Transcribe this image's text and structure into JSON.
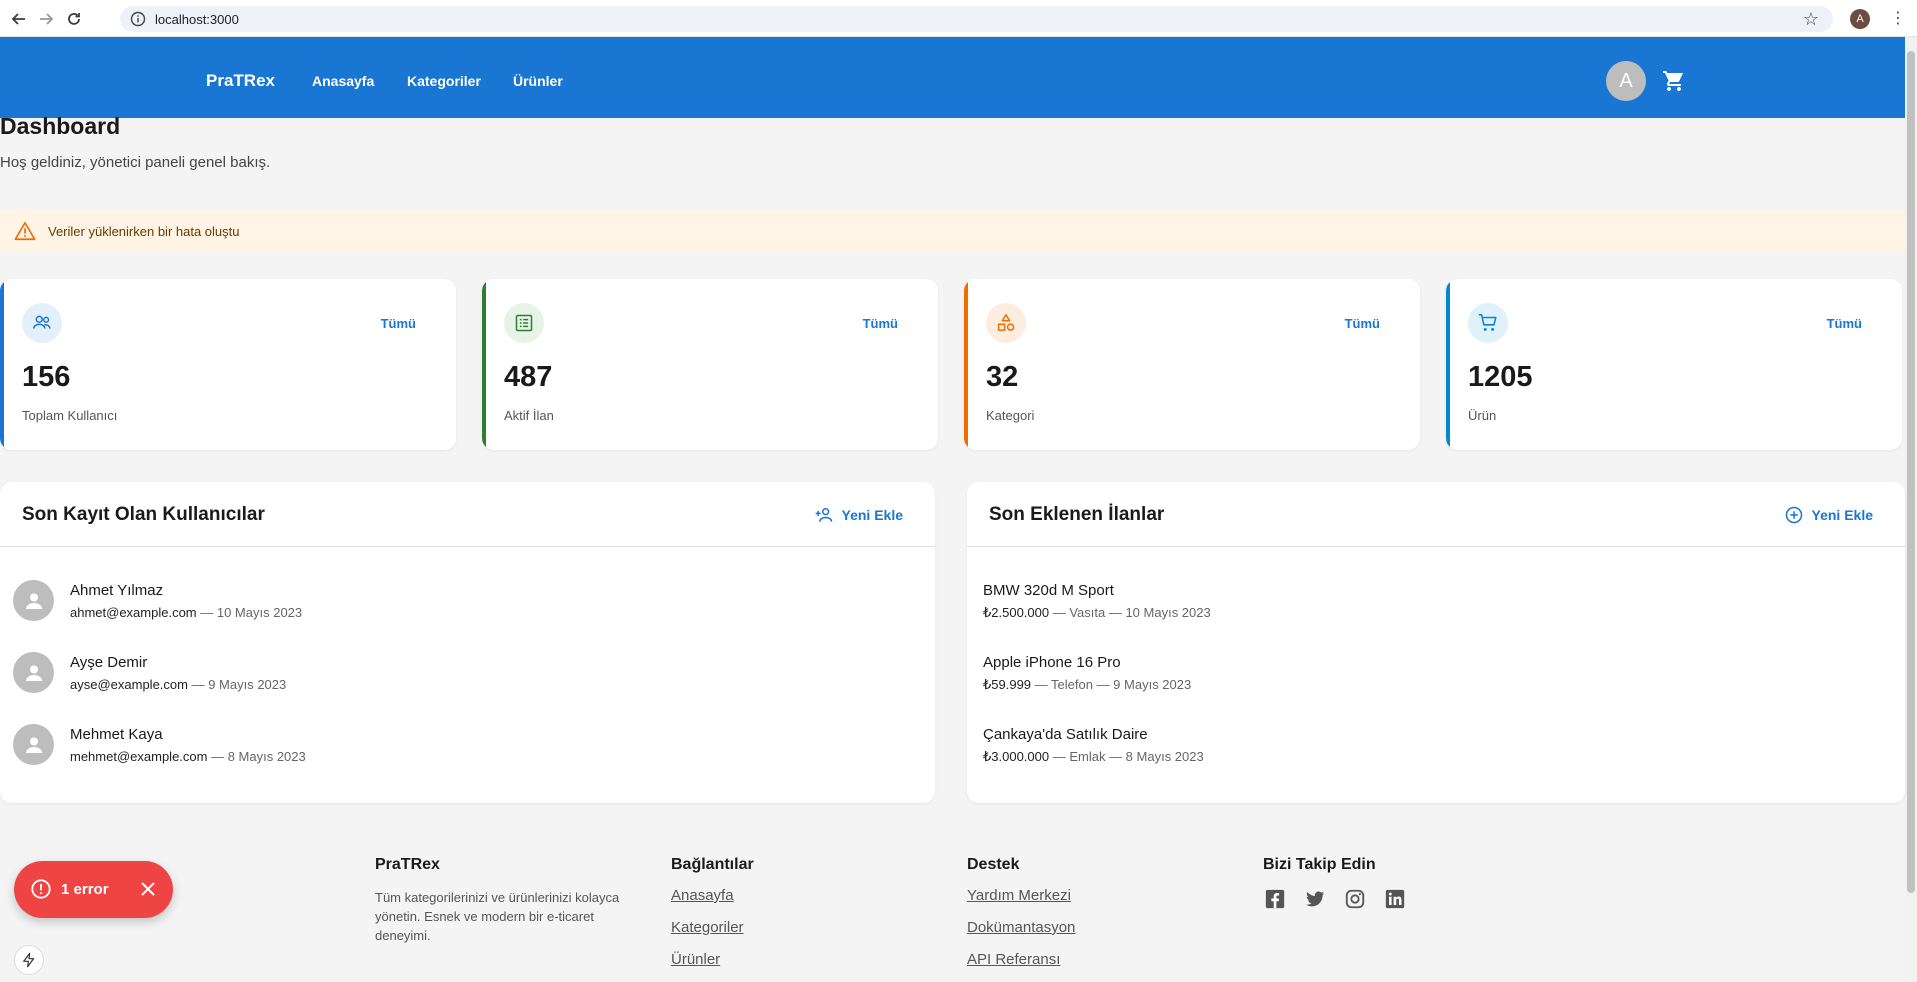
{
  "browser": {
    "url": "localhost:3000",
    "profile_initial": "A"
  },
  "appbar": {
    "brand": "PraTRex",
    "nav": [
      "Anasayfa",
      "Kategoriler",
      "Ürünler"
    ],
    "avatar_initial": "A",
    "color": "#1976d2"
  },
  "page": {
    "title": "Dashboard",
    "subtitle": "Hoş geldiniz, yönetici paneli genel bakış."
  },
  "alert": {
    "message": "Veriler yüklenirken bir hata oluştu",
    "icon": "warning-icon"
  },
  "stats": [
    {
      "value": "156",
      "label": "Toplam Kullanıcı",
      "link": "Tümü",
      "icon": "users-icon",
      "accent": "#1976d2"
    },
    {
      "value": "487",
      "label": "Aktif İlan",
      "link": "Tümü",
      "icon": "list-icon",
      "accent": "#2e7d32"
    },
    {
      "value": "32",
      "label": "Kategori",
      "link": "Tümü",
      "icon": "category-icon",
      "accent": "#ef6c00"
    },
    {
      "value": "1205",
      "label": "Ürün",
      "link": "Tümü",
      "icon": "cart-icon",
      "accent": "#0288d1"
    }
  ],
  "users_panel": {
    "title": "Son Kayıt Olan Kullanıcılar",
    "add_label": "Yeni Ekle",
    "items": [
      {
        "name": "Ahmet Yılmaz",
        "email": "ahmet@example.com",
        "meta": " — 10 Mayıs 2023"
      },
      {
        "name": "Ayşe Demir",
        "email": "ayse@example.com",
        "meta": " — 9 Mayıs 2023"
      },
      {
        "name": "Mehmet Kaya",
        "email": "mehmet@example.com",
        "meta": " — 8 Mayıs 2023"
      }
    ]
  },
  "listings_panel": {
    "title": "Son Eklenen İlanlar",
    "add_label": "Yeni Ekle",
    "items": [
      {
        "title": "BMW 320d M Sport",
        "price": "₺2.500.000",
        "meta": " — Vasıta — 10 Mayıs 2023"
      },
      {
        "title": "Apple iPhone 16 Pro",
        "price": "₺59.999",
        "meta": " — Telefon — 9 Mayıs 2023"
      },
      {
        "title": "Çankaya'da Satılık Daire",
        "price": "₺3.000.000",
        "meta": " — Emlak — 8 Mayıs 2023"
      }
    ]
  },
  "footer": {
    "brand_title": "PraTRex",
    "brand_desc": "Tüm kategorilerinizi ve ürünlerinizi kolayca yönetin. Esnek ve modern bir e-ticaret deneyimi.",
    "links_title": "Bağlantılar",
    "links": [
      "Anasayfa",
      "Kategoriler",
      "Ürünler"
    ],
    "support_title": "Destek",
    "support_links": [
      "Yardım Merkezi",
      "Dokümantasyon",
      "API Referansı"
    ],
    "social_title": "Bizi Takip Edin",
    "social_icons": [
      "facebook-icon",
      "twitter-icon",
      "instagram-icon",
      "linkedin-icon"
    ]
  },
  "error_toast": {
    "label": "1 error",
    "color": "#ef4444"
  }
}
